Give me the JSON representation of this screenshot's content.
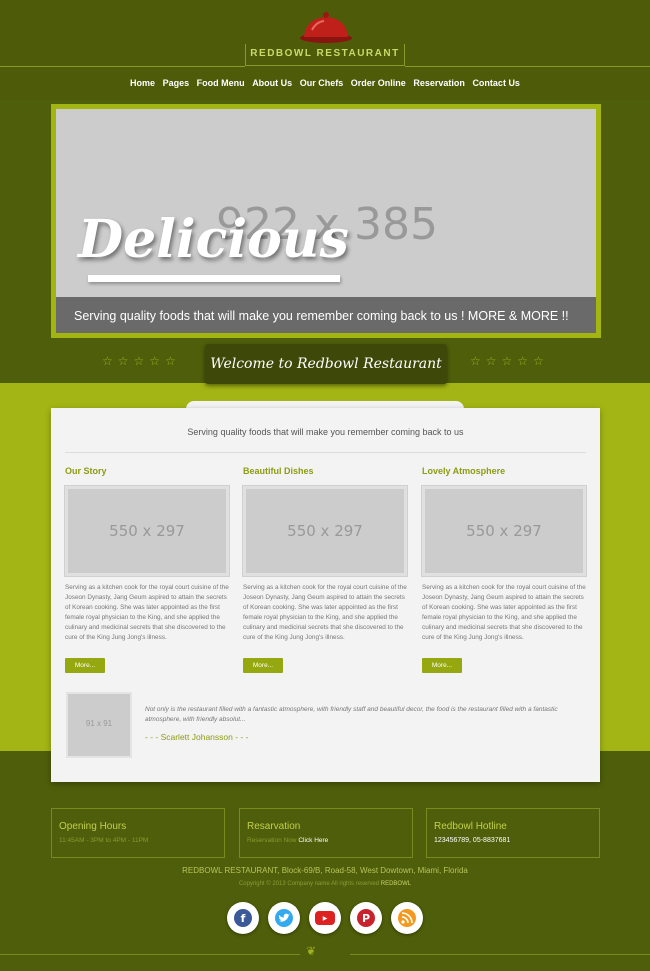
{
  "header": {
    "brand": "REDBOWL RESTAURANT",
    "nav": [
      "Home",
      "Pages",
      "Food Menu",
      "About Us",
      "Our Chefs",
      "Order Online",
      "Reservation",
      "Contact Us"
    ]
  },
  "hero": {
    "placeholder": "922 x 385",
    "title": "Delicious",
    "caption": "Serving quality foods that will make you remember coming back to us ! MORE & MORE !!"
  },
  "welcome": {
    "title": "Welcome to Redbowl Restaurant",
    "stars": "☆☆☆☆☆"
  },
  "panel": {
    "tagline": "Serving quality foods that will make you remember coming back to us",
    "columns": [
      {
        "title": "Our Story",
        "image": "550 x 297",
        "text": "Serving as a kitchen cook for the royal court cuisine of the Joseon Dynasty, Jang Geum aspired to attain the secrets of Korean cooking. She was later appointed as the first female royal physician to the King, and she applied the culinary and medicinal secrets that she discovered to the cure of the King Jung Jong's illness.",
        "button": "More..."
      },
      {
        "title": "Beautiful Dishes",
        "image": "550 x 297",
        "text": "Serving as a kitchen cook for the royal court cuisine of the Joseon Dynasty, Jang Geum aspired to attain the secrets of Korean cooking. She was later appointed as the first female royal physician to the King, and she applied the culinary and medicinal secrets that she discovered to the cure of the King Jung Jong's illness.",
        "button": "More..."
      },
      {
        "title": "Lovely Atmosphere",
        "image": "550 x 297",
        "text": "Serving as a kitchen cook for the royal court cuisine of the Joseon Dynasty, Jang Geum aspired to attain the secrets of Korean cooking. She was later appointed as the first female royal physician to the King, and she applied the culinary and medicinal secrets that she discovered to the cure of the King Jung Jong's illness.",
        "button": "More..."
      }
    ],
    "testimonial": {
      "image": "91 x 91",
      "text": "Not only is the restaurant filled with a fantastic atmosphere, with friendly staff and beautiful decor, the food is the restaurant filled with a fantastic atmosphere, with friendly absolut...",
      "author": "- - - Scarlett Johansson - - -"
    }
  },
  "footer": {
    "hours_title": "Opening Hours",
    "hours_text": "11:45AM - 3PM to 4PM - 11PM",
    "reservation_title": "Resarvation",
    "reservation_text": "Reservation Now",
    "reservation_link": "Click Here",
    "hotline_title": "Redbowl Hotline",
    "hotline_text": "123456789, 05-8837681",
    "address": "REDBOWL RESTAURANT, Block-69/B, Road-58, West Dowtown, Miami, Florida",
    "copyright": "Copyright © 2013 Company name All rights reserved",
    "copyright_brand": "REDBOWL",
    "social": [
      "facebook-icon",
      "twitter-icon",
      "youtube-icon",
      "pinterest-icon",
      "rss-icon"
    ]
  },
  "colors": {
    "background": "#4f5e0a",
    "accent": "#a3b514",
    "panel": "#f3f3f3",
    "cloche": "#c0201a"
  }
}
